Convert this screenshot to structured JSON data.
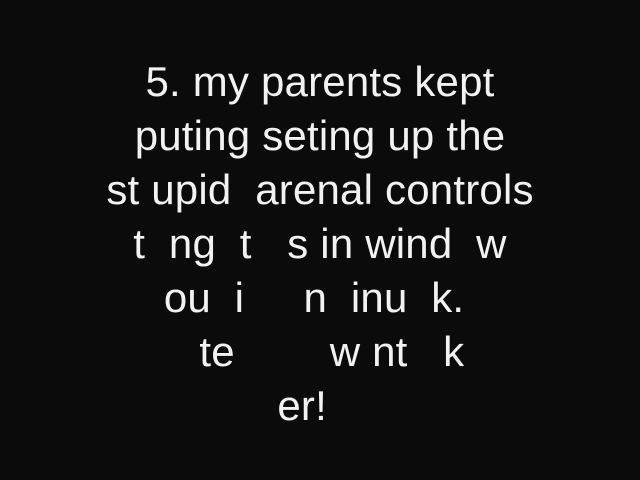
{
  "lines": [
    "5. my parents kept",
    "puting seting up the",
    "st upid  arenal controls",
    "t  ng  t   s in wind  w",
    " ou  i     n  inu  k.  ",
    "  te        w nt   k",
    "er!   "
  ]
}
